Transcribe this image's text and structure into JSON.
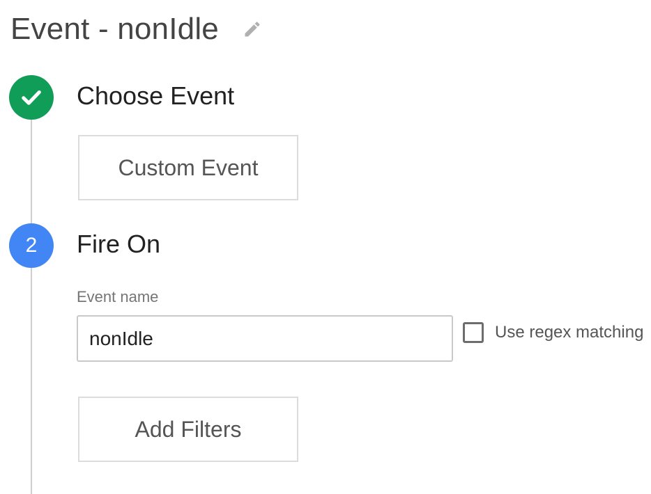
{
  "header": {
    "title": "Event - nonIdle",
    "edit_icon": "pencil-icon"
  },
  "steps": [
    {
      "status": "complete",
      "icon": "check-icon",
      "title": "Choose Event",
      "button_label": "Custom Event"
    },
    {
      "status": "active",
      "number": "2",
      "title": "Fire On",
      "event_name": {
        "label": "Event name",
        "value": "nonIdle"
      },
      "regex_checkbox": {
        "label": "Use regex matching",
        "checked": false
      },
      "button_label": "Add Filters"
    }
  ],
  "colors": {
    "complete": "#0f9d58",
    "active": "#4285f4",
    "line": "#cfcfcf"
  }
}
